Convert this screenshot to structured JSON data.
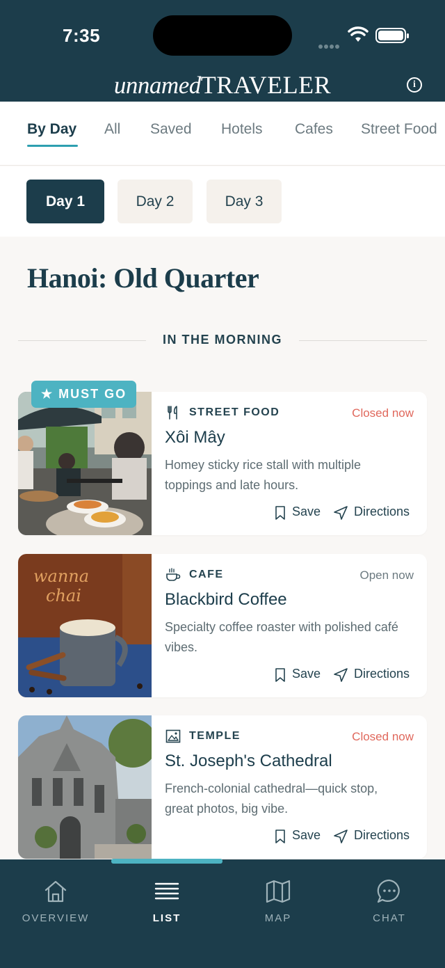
{
  "status_bar": {
    "time": "7:35"
  },
  "header": {
    "brand_italic": "unnamed",
    "brand_caps": "TRAVELER",
    "info_icon": "info-icon"
  },
  "tabs": [
    {
      "label": "By Day",
      "active": true
    },
    {
      "label": "All"
    },
    {
      "label": "Saved"
    },
    {
      "label": "Hotels"
    },
    {
      "label": "Cafes"
    },
    {
      "label": "Street Food"
    }
  ],
  "days": [
    {
      "label": "Day 1",
      "active": true
    },
    {
      "label": "Day 2"
    },
    {
      "label": "Day 3"
    }
  ],
  "section": {
    "title": "Hanoi: Old Quarter",
    "time_of_day": "IN THE MORNING"
  },
  "badges": {
    "must_go": "★ MUST GO"
  },
  "places": [
    {
      "category": "STREET FOOD",
      "category_icon": "fork-knife-icon",
      "status": "Closed now",
      "name": "Xôi Mây",
      "description": "Homey sticky rice stall with multiple toppings and late hours.",
      "save_label": "Save",
      "directions_label": "Directions",
      "photo": "street-food-photo"
    },
    {
      "category": "CAFE",
      "category_icon": "coffee-cup-icon",
      "status": "Open now",
      "name": "Blackbird Coffee",
      "description": "Specialty coffee roaster with polished café vibes.",
      "save_label": "Save",
      "directions_label": "Directions",
      "photo": "coffee-photo",
      "photo_text": "wanna chai"
    },
    {
      "category": "TEMPLE",
      "category_icon": "image-icon",
      "status": "Closed now",
      "name": "St. Joseph's Cathedral",
      "description": "French-colonial cathedral—quick stop, great photos, big vibe.",
      "save_label": "Save",
      "directions_label": "Directions",
      "photo": "cathedral-photo"
    }
  ],
  "bottom_nav": [
    {
      "label": "OVERVIEW",
      "icon": "home-icon"
    },
    {
      "label": "LIST",
      "icon": "list-icon",
      "active": true
    },
    {
      "label": "MAP",
      "icon": "map-icon"
    },
    {
      "label": "CHAT",
      "icon": "chat-bubble-icon"
    }
  ],
  "colors": {
    "primary": "#1c3d4b",
    "accent": "#4db3c2",
    "closed": "#e0685c",
    "pill": "#f5f1ec",
    "background": "#f9f7f5"
  }
}
